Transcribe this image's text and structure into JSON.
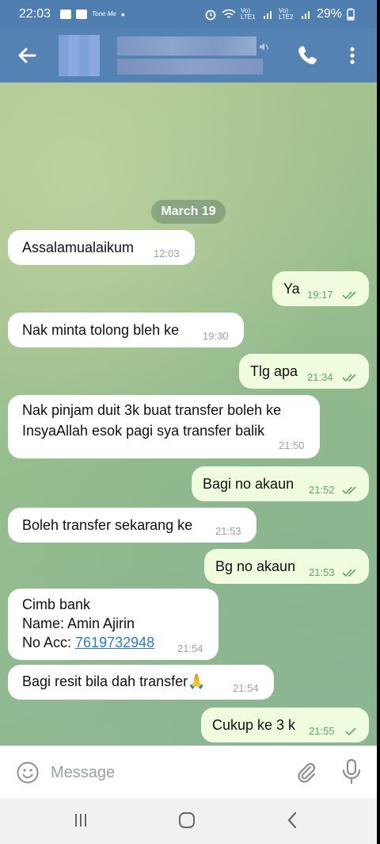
{
  "status_bar": {
    "time": "22:03",
    "notif_small": "Tone Me",
    "dot": "•",
    "network1": "Vo) LTE1",
    "network2": "Vo) LTE2",
    "battery": "29%"
  },
  "header": {
    "back_icon": "arrow-left-icon",
    "call_icon": "phone-icon",
    "more_icon": "more-vertical-icon"
  },
  "chat": {
    "date_label": "March 19",
    "messages": [
      {
        "dir": "in",
        "text": "Assalamualaikum",
        "time": "12:03"
      },
      {
        "dir": "out",
        "text": "Ya",
        "time": "19:17",
        "status": "read"
      },
      {
        "dir": "in",
        "text": "Nak minta tolong bleh ke",
        "time": "19:30"
      },
      {
        "dir": "out",
        "text": "Tlg apa",
        "time": "21:34",
        "status": "read"
      },
      {
        "dir": "in",
        "text": "Nak pinjam duit 3k buat transfer boleh ke\nInsyaAllah esok pagi sya transfer balik",
        "time": "21:50"
      },
      {
        "dir": "out",
        "text": "Bagi no akaun",
        "time": "21:52",
        "status": "read"
      },
      {
        "dir": "in",
        "text": "Boleh transfer sekarang ke",
        "time": "21:53"
      },
      {
        "dir": "out",
        "text": "Bg no akaun",
        "time": "21:53",
        "status": "read"
      },
      {
        "dir": "in",
        "text": "Cimb bank\nName: Amin Ajirin\nNo Acc: ",
        "link": "7619732948",
        "time": "21:54"
      },
      {
        "dir": "in",
        "text": "Bagi resit bila dah transfer",
        "emoji": "🙏",
        "time": "21:54"
      },
      {
        "dir": "out",
        "text": "Cukup ke 3 k",
        "time": "21:55",
        "status": "sent"
      }
    ]
  },
  "input": {
    "placeholder": "Message",
    "emoji_icon": "smile-icon",
    "attach_icon": "paperclip-icon",
    "mic_icon": "microphone-icon"
  },
  "nav": {
    "recents_icon": "recents-icon",
    "home_icon": "home-icon",
    "back_icon": "back-icon"
  },
  "colors": {
    "header": "#5382b3",
    "bubble_in": "#ffffff",
    "bubble_out": "#effdde",
    "time_out": "#5fa760",
    "link": "#2b7cc0"
  }
}
